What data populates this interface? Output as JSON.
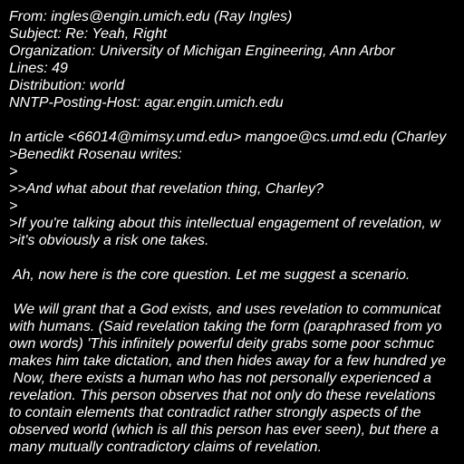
{
  "lines": [
    "From: ingles@engin.umich.edu (Ray Ingles)",
    "Subject: Re: Yeah, Right",
    "Organization: University of Michigan Engineering, Ann Arbor",
    "Lines: 49",
    "Distribution: world",
    "NNTP-Posting-Host: agar.engin.umich.edu",
    "",
    "In article <66014@mimsy.umd.edu> mangoe@cs.umd.edu (Charley",
    ">Benedikt Rosenau writes:",
    ">",
    ">>And what about that revelation thing, Charley?",
    ">",
    ">If you're talking about this intellectual engagement of revelation, w",
    ">it's obviously a risk one takes.",
    "",
    " Ah, now here is the core question. Let me suggest a scenario.",
    "",
    " We will grant that a God exists, and uses revelation to communicat",
    "with humans. (Said revelation taking the form (paraphrased from yo",
    "own words) 'This infinitely powerful deity grabs some poor schmuc",
    "makes him take dictation, and then hides away for a few hundred ye",
    " Now, there exists a human who has not personally experienced a",
    "revelation. This person observes that not only do these revelations",
    "to contain elements that contradict rather strongly aspects of the",
    "observed world (which is all this person has ever seen), but there a",
    "many mutually contradictory claims of revelation."
  ]
}
